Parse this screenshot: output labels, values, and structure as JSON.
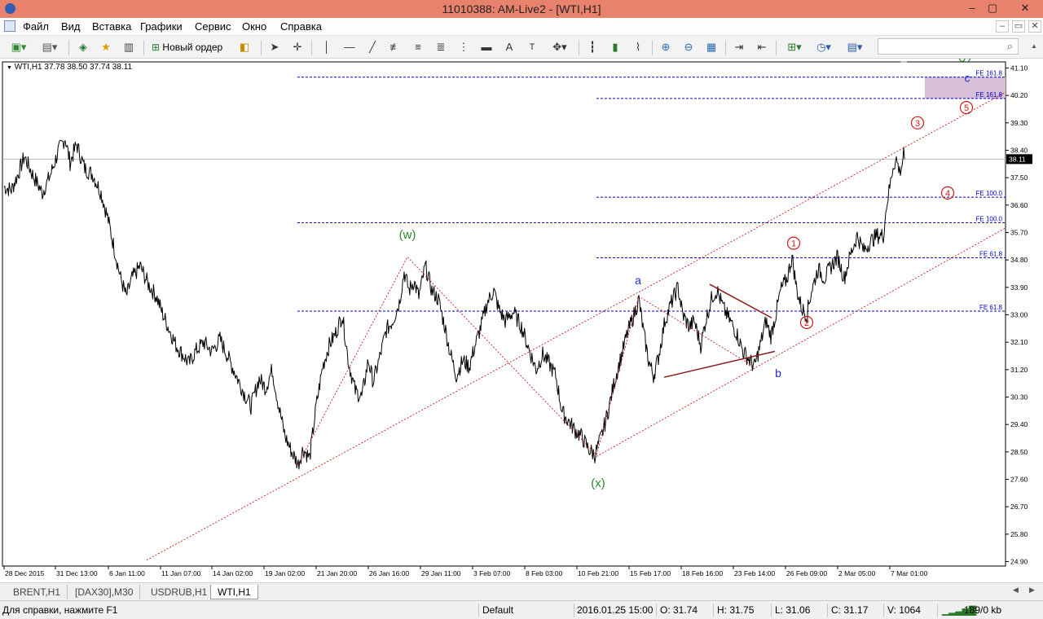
{
  "window": {
    "title": "11010388: AM-Live2 - [WTI,H1]",
    "controls": [
      "–",
      "▢",
      "✕"
    ],
    "mdi_controls": [
      "–",
      "▭",
      "✕"
    ]
  },
  "menu": [
    "Файл",
    "Вид",
    "Вставка",
    "Графики",
    "Сервис",
    "Окно",
    "Справка"
  ],
  "toolbar": {
    "new_order_label": "Новый ордер",
    "search_placeholder": ""
  },
  "chart": {
    "ohlc_label": "WTI,H1  37.78 38.50 37.74 38.11",
    "current_price_label": "38.11",
    "price_ticks": [
      "41.10",
      "40.20",
      "39.30",
      "38.40",
      "37.50",
      "36.60",
      "35.70",
      "34.80",
      "33.90",
      "33.00",
      "32.10",
      "31.20",
      "30.30",
      "29.40",
      "28.50",
      "27.60",
      "26.70",
      "25.80",
      "24.90"
    ],
    "time_ticks": [
      "28 Dec 2015",
      "31 Dec 13:00",
      "6 Jan 11:00",
      "11 Jan 07:00",
      "14 Jan 02:00",
      "19 Jan 02:00",
      "21 Jan 20:00",
      "26 Jan 16:00",
      "29 Jan 11:00",
      "3 Feb 07:00",
      "8 Feb 03:00",
      "10 Feb 21:00",
      "15 Feb 17:00",
      "18 Feb 16:00",
      "23 Feb 14:00",
      "26 Feb 09:00",
      "2 Mar 05:00",
      "7 Mar 01:00"
    ],
    "fib_levels": [
      {
        "label": "FE 161.8",
        "price": 40.8
      },
      {
        "label": "FE 161.8",
        "price": 40.1
      },
      {
        "label": "FE 100.0",
        "price": 36.86
      },
      {
        "label": "FE 100.0",
        "price": 36.02
      },
      {
        "label": "FE 61.8",
        "price": 34.87
      },
      {
        "label": "FE 61.8",
        "price": 33.12
      }
    ],
    "wave_labels": {
      "w": "(w)",
      "x": "(x)",
      "y": "(y)",
      "a": "a",
      "b": "b",
      "c": "c",
      "one": "1",
      "two": "2",
      "three": "3",
      "four": "4",
      "five": "5"
    },
    "colors": {
      "price_line": "#000000",
      "fib_line": "#0000c8",
      "channel": "#c00000",
      "triangle": "#8b1a1a",
      "wave_green": "#2a8a2a",
      "wave_blue": "#1f2fcf",
      "wave_red": "#d01818",
      "target_zone": "#d8bfd8"
    }
  },
  "tabs": [
    "BRENT,H1",
    "[DAX30],M30",
    "USDRUB,H1",
    "WTI,H1"
  ],
  "status": {
    "help": "Для справки, нажмите F1",
    "profile": "Default",
    "datetime": "2016.01.25 15:00",
    "open": "O: 31.74",
    "high": "H: 31.75",
    "low": "L: 31.06",
    "close": "C: 31.17",
    "volume": "V: 1064",
    "traffic": "189/0 kb"
  }
}
